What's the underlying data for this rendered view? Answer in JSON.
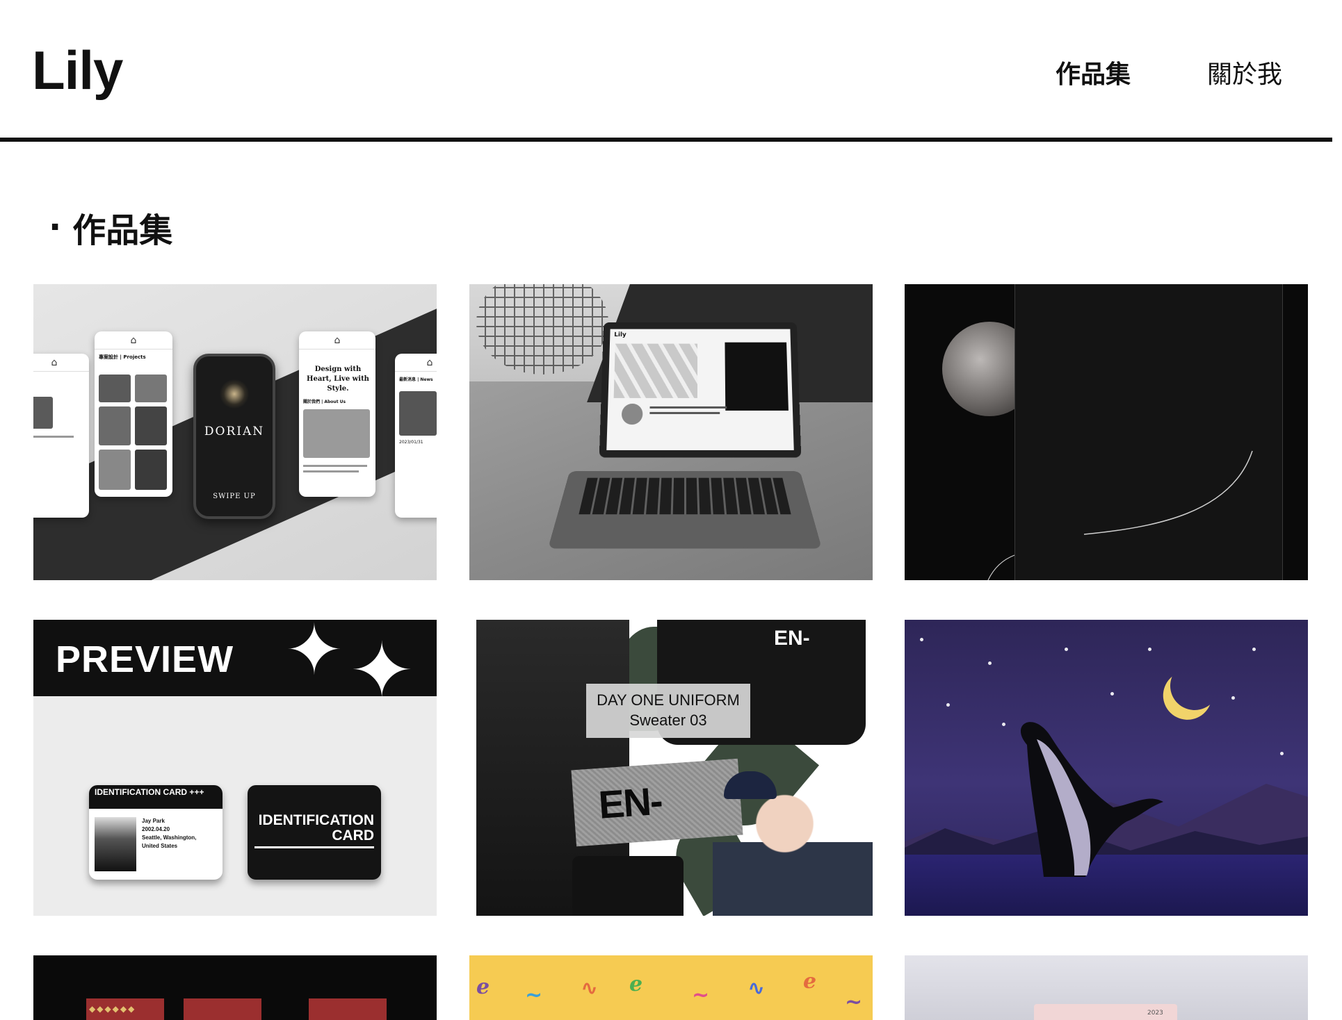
{
  "header": {
    "logo": "Lily",
    "nav": [
      {
        "label": "作品集",
        "active": true
      },
      {
        "label": "關於我",
        "active": false
      }
    ]
  },
  "section": {
    "bullet": "·",
    "title": "作品集"
  },
  "tiles": [
    {
      "texts": [
        "專案設計 | Projects",
        "Design with Heart, Live with Style.",
        "關於我們 | About Us",
        "最新消息 | News",
        "DORIAN",
        "SWIPE UP",
        "2023/01/31"
      ]
    },
    {
      "texts": [
        "Lily"
      ]
    },
    {
      "texts": []
    },
    {
      "texts": [
        "PREVIEW",
        "IDENTIFICATION CARD +++",
        "Jay Park",
        "2002.04.20",
        "Seattle, Washington, United States",
        "IDENTIFICATION",
        "CARD"
      ]
    },
    {
      "texts": [
        "DAY ONE UNIFORM",
        "Sweater 03",
        "EN-",
        "EN-"
      ]
    },
    {
      "texts": []
    },
    {
      "texts": []
    },
    {
      "texts": []
    },
    {
      "texts": [
        "2023"
      ]
    }
  ],
  "colors": {
    "text": "#111111",
    "rule": "#111111",
    "moon_yellow": "#f1d36a",
    "night_purple": "#3e3476",
    "tile8_yellow": "#f6cb52",
    "red_card": "#9b2f2f"
  }
}
